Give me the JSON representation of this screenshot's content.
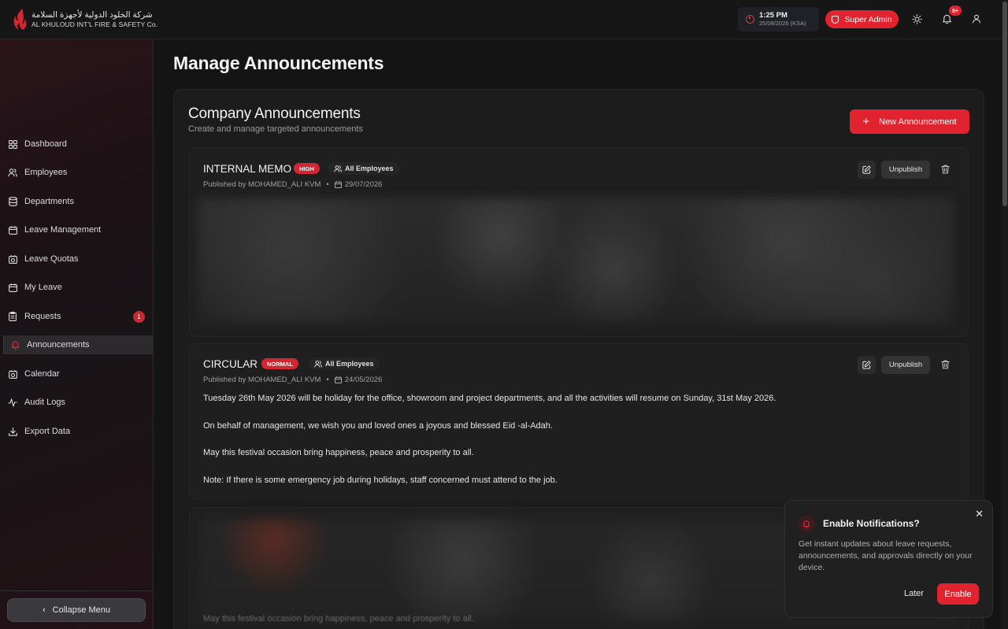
{
  "header": {
    "company_ar": "شركة الخلود الدولية لأجهزة السلامة",
    "company_en": "AL KHULOUD INT'L FIRE & SAFETY Co.",
    "time": "1:25 PM",
    "date": "25/08/2026 (KSA)",
    "role": "Super Admin",
    "notification_count": "9+"
  },
  "sidebar": {
    "items": [
      {
        "label": "Dashboard",
        "icon": "grid-icon"
      },
      {
        "label": "Employees",
        "icon": "users-icon"
      },
      {
        "label": "Departments",
        "icon": "database-icon"
      },
      {
        "label": "Leave Management",
        "icon": "calendar-icon"
      },
      {
        "label": "Leave Quotas",
        "icon": "calendar-clock-icon"
      },
      {
        "label": "My Leave",
        "icon": "calendar-icon"
      },
      {
        "label": "Requests",
        "icon": "clipboard-icon",
        "badge": "1"
      },
      {
        "label": "Announcements",
        "icon": "bell-icon",
        "active": true
      },
      {
        "label": "Calendar",
        "icon": "calendar-icon"
      },
      {
        "label": "Audit Logs",
        "icon": "activity-icon"
      },
      {
        "label": "Export Data",
        "icon": "download-icon"
      }
    ],
    "collapse_label": "Collapse Menu"
  },
  "main": {
    "page_title": "Manage Announcements",
    "panel_title": "Company Announcements",
    "panel_subtitle": "Create and manage targeted announcements",
    "new_button": "New Announcement",
    "announcements": [
      {
        "title": "INTERNAL MEMO",
        "priority": "HIGH",
        "audience": "All Employees",
        "published_by": "Published by MOHAMED_ALI KVM",
        "date": "29/07/2026",
        "unpublish_label": "Unpublish"
      },
      {
        "title": "CIRCULAR",
        "priority": "NORMAL",
        "audience": "All Employees",
        "published_by": "Published by MOHAMED_ALI KVM",
        "date": "24/05/2026",
        "unpublish_label": "Unpublish",
        "body": [
          "Tuesday 26th May 2026 will be holiday for the office, showroom and project departments, and all the activities will resume on Sunday, 31st May 2026.",
          "On behalf of management, we wish you and loved ones a joyous and blessed Eid -al-Adah.",
          "May this festival occasion bring happiness, peace and prosperity to all.",
          "Note: If there is some emergency job during holidays, staff concerned must attend to the job."
        ]
      },
      {
        "partial_text": "May this festival occasion bring happiness, peace and prosperity to all."
      }
    ]
  },
  "toast": {
    "title": "Enable Notifications?",
    "body": "Get instant updates about leave requests, announcements, and approvals directly on your device.",
    "later": "Later",
    "enable": "Enable"
  },
  "colors": {
    "accent": "#e0232f",
    "background": "#141414"
  }
}
